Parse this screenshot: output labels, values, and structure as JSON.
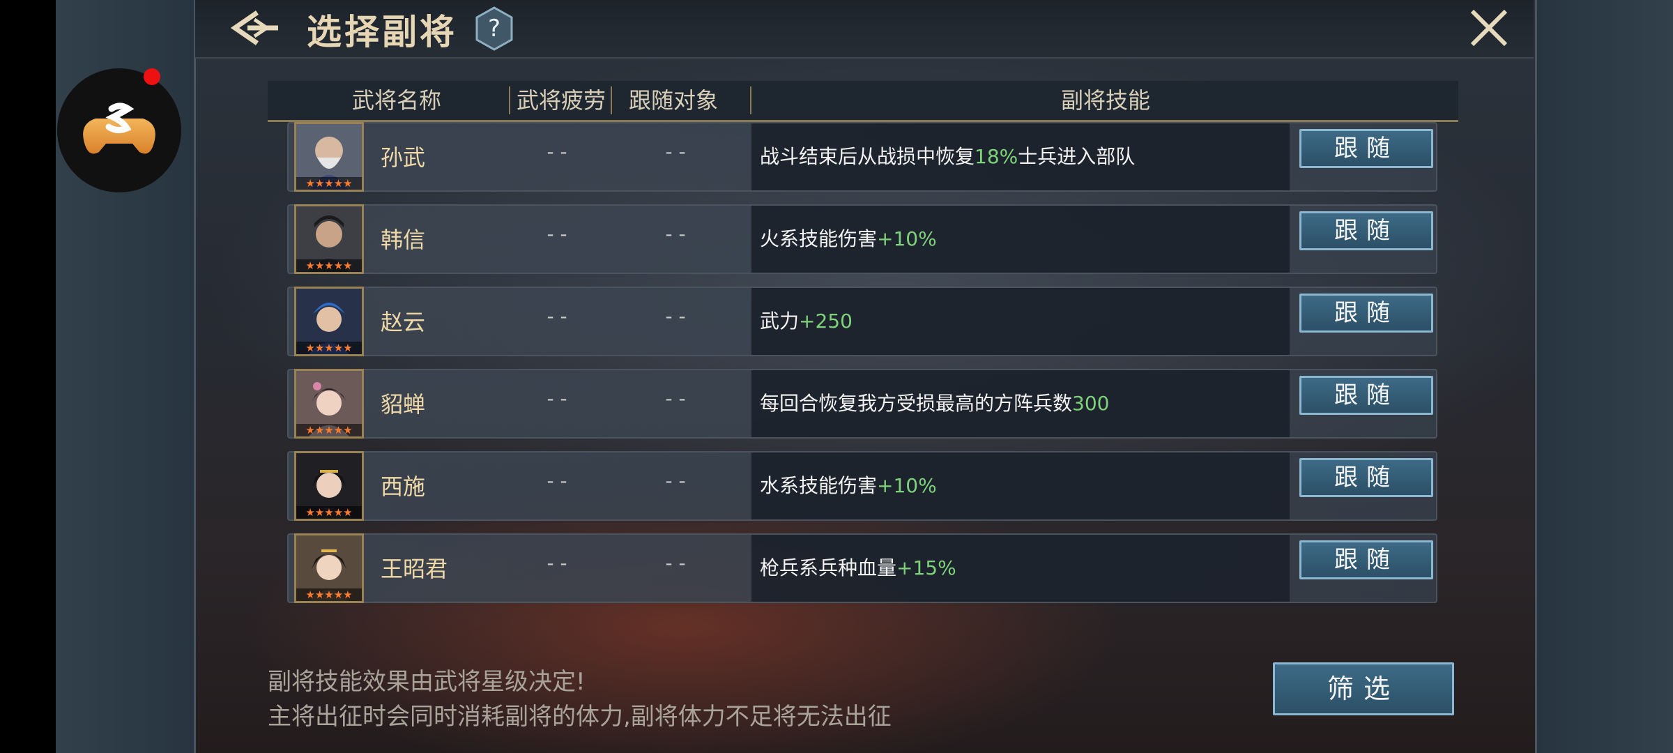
{
  "header": {
    "title": "选择副将",
    "help_label": "?"
  },
  "table": {
    "columns": [
      "武将名称",
      "武将疲劳",
      "跟随对象",
      "副将技能"
    ],
    "rows": [
      {
        "name": "孙武",
        "stars": "★★★★★",
        "fatigue": "- -",
        "follow_target": "- -",
        "skill_prefix": "战斗结束后从战损中恢复",
        "skill_value": "18%",
        "skill_suffix": "士兵进入部队",
        "button": "跟随"
      },
      {
        "name": "韩信",
        "stars": "★★★★★",
        "fatigue": "- -",
        "follow_target": "- -",
        "skill_prefix": "火系技能伤害",
        "skill_value": "+10%",
        "skill_suffix": "",
        "button": "跟随"
      },
      {
        "name": "赵云",
        "stars": "★★★★★",
        "fatigue": "- -",
        "follow_target": "- -",
        "skill_prefix": "武力",
        "skill_value": "+250",
        "skill_suffix": "",
        "button": "跟随"
      },
      {
        "name": "貂蝉",
        "stars": "★★★★★",
        "fatigue": "- -",
        "follow_target": "- -",
        "skill_prefix": "每回合恢复我方受损最高的方阵兵数",
        "skill_value": "300",
        "skill_suffix": "",
        "button": "跟随"
      },
      {
        "name": "西施",
        "stars": "★★★★★",
        "fatigue": "- -",
        "follow_target": "- -",
        "skill_prefix": "水系技能伤害",
        "skill_value": "+10%",
        "skill_suffix": "",
        "button": "跟随"
      },
      {
        "name": "王昭君",
        "stars": "★★★★★",
        "fatigue": "- -",
        "follow_target": "- -",
        "skill_prefix": "枪兵系兵种血量",
        "skill_value": "+15%",
        "skill_suffix": "",
        "button": "跟随"
      }
    ]
  },
  "footer": {
    "tip1": "副将技能效果由武将星级决定!",
    "tip2": "主将出征时会同时消耗副将的体力,副将体力不足将无法出征",
    "filter_label": "筛选"
  },
  "colors": {
    "accent_gold": "#e6d6b4",
    "bonus_green": "#7ed37a",
    "button_blue": "#2c5067",
    "notification_red": "#e11111"
  },
  "icons": {
    "back": "back-arrow-icon",
    "help": "question-mark-icon",
    "close": "close-icon",
    "floating": "gamepad-icon"
  }
}
